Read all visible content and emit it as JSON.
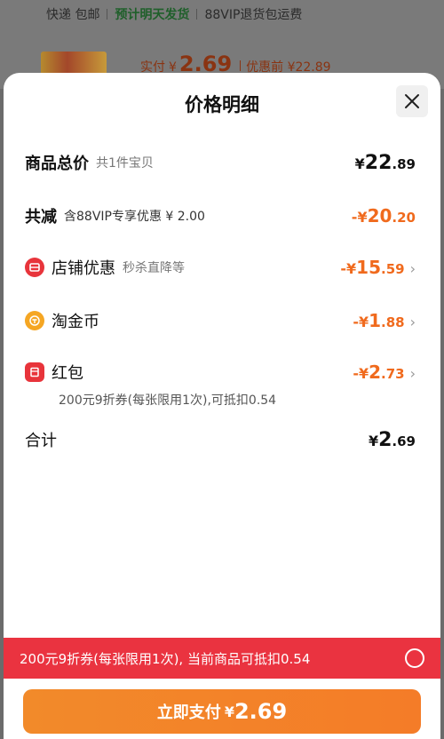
{
  "background": {
    "shipping": "快递 包邮",
    "dispatch": "预计明天发货",
    "vip_note": "88VIP退货包运费",
    "price_prefix": "实付",
    "price_cur": "¥",
    "price_value": "2.69",
    "price_before": "优惠前 ¥22.89"
  },
  "sheet": {
    "title": "价格明细",
    "close_icon": "close-icon"
  },
  "rows": {
    "total": {
      "label": "商品总价",
      "sub": "共1件宝贝",
      "cur": "¥",
      "int": "22",
      "dec": ".89"
    },
    "reduce": {
      "label": "共减",
      "sub": "含88VIP专享优惠 ¥ 2.00",
      "cur": "-¥",
      "int": "20",
      "dec": ".20"
    },
    "shop": {
      "label": "店铺优惠",
      "sub": "秒杀直降等",
      "cur": "-¥",
      "int": "15",
      "dec": ".59",
      "icon": "shop-icon"
    },
    "coin": {
      "label": "淘金币",
      "cur": "-¥",
      "int": "1",
      "dec": ".88",
      "icon": "coin-icon"
    },
    "redbag": {
      "label": "红包",
      "cur": "-¥",
      "int": "2",
      "dec": ".73",
      "note": "200元9折券(每张限用1次),可抵扣0.54",
      "icon": "red-packet-icon"
    },
    "sum": {
      "label": "合计",
      "cur": "¥",
      "int": "2",
      "dec": ".69"
    }
  },
  "coupon_bar": {
    "text": "200元9折券(每张限用1次), 当前商品可抵扣0.54"
  },
  "pay": {
    "label": "立即支付",
    "cur": "¥",
    "value": "2.69"
  },
  "colors": {
    "accent": "#f06a1d",
    "coupon": "#ea3340",
    "pay": "#f28a2a"
  }
}
